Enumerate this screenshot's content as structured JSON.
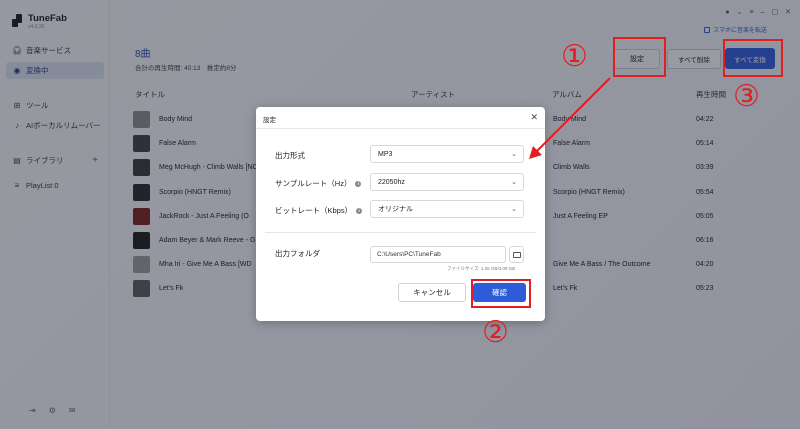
{
  "app": {
    "name": "TuneFab",
    "version": "v4.0.30"
  },
  "window_controls": [
    "avatar",
    "menu",
    "minimize",
    "maximize",
    "close"
  ],
  "promo": {
    "label": "スマホに音楽を転送"
  },
  "sidebar": {
    "items": [
      {
        "label": "音楽サービス",
        "icon": "headphones-icon",
        "active": false
      },
      {
        "label": "変換中",
        "icon": "converting-icon",
        "active": true
      },
      {
        "label": "ツール",
        "icon": "grid-icon",
        "active": false
      },
      {
        "label": "AIボーカルリムーバー",
        "icon": "vocal-remover-icon",
        "active": false
      },
      {
        "label": "ライブラリ",
        "icon": "library-icon",
        "active": false
      },
      {
        "label": "PlayList 0",
        "icon": "playlist-icon",
        "active": false
      }
    ],
    "bottom_icons": [
      "logout-icon",
      "settings-icon",
      "mail-icon"
    ]
  },
  "header": {
    "count": "8曲",
    "summary": "合計の再生時間: 40:13　推定約8分"
  },
  "toolbar": {
    "settings_label": "設定",
    "delete_all_label": "すべて削除",
    "convert_all_label": "すべて変換"
  },
  "table": {
    "columns": [
      "タイトル",
      "アーティスト",
      "アルバム",
      "再生時間"
    ],
    "rows": [
      {
        "title": "Body Mind",
        "album": "Body Mind",
        "duration": "04:22",
        "thumb": "#8a8a8a"
      },
      {
        "title": "False Alarm",
        "album": "False Alarm",
        "duration": "05:14",
        "thumb": "#404040"
      },
      {
        "title": "Meg McHugh - Climb Walls [NC",
        "album": "Climb Walls",
        "duration": "03:39",
        "thumb": "#3a3a3a"
      },
      {
        "title": "Scorpio (HNGT Remix)",
        "album": "Scorpio (HNGT Remix)",
        "duration": "05:54",
        "thumb": "#2a2a2a"
      },
      {
        "title": "JackRock - Just A Feeling (O",
        "album": "Just A Feeling EP",
        "duration": "05:05",
        "thumb": "#7a2020"
      },
      {
        "title": "Adam Beyer & Mark Reeve - G",
        "album": "",
        "duration": "06:16",
        "thumb": "#1e1e1e"
      },
      {
        "title": "Mha Iri - Give Me A Bass [WD",
        "album": "Give Me A Bass / The Outcome",
        "duration": "04:20",
        "thumb": "#9a9a9a"
      },
      {
        "title": "Let's Fk",
        "album": "Let's Fk",
        "duration": "05:23",
        "thumb": "#5a5a5a"
      }
    ]
  },
  "dialog": {
    "title": "設定",
    "fields": [
      {
        "label": "出力形式",
        "value": "MP3",
        "info": false
      },
      {
        "label": "サンプルレート（Hz）",
        "value": "22050hz",
        "info": true
      },
      {
        "label": "ビットレート（Kbps）",
        "value": "オリジナル",
        "info": true
      }
    ],
    "folder_label": "出力フォルダ",
    "folder_path": "C:\\Users\\PC\\TuneFab",
    "file_size": "ファイルサイズ: 1.05 GB/3.09 GB",
    "cancel_label": "キャンセル",
    "ok_label": "確認"
  },
  "annotations": {
    "color": "#e02020",
    "labels": [
      "①",
      "②",
      "③"
    ]
  },
  "colors": {
    "accent": "#2e5bd7",
    "active_nav": "#1f3b8f"
  }
}
